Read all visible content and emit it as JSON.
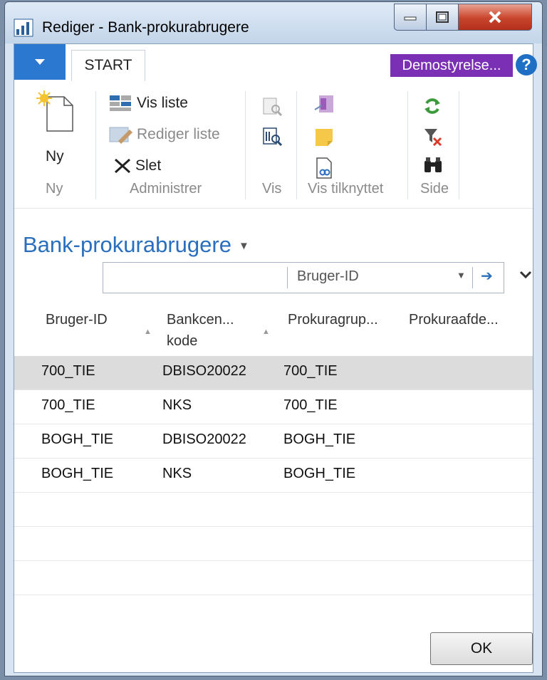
{
  "window": {
    "title": "Rediger - Bank-prokurabrugere"
  },
  "tabs": {
    "start_label": "START"
  },
  "company": {
    "label": "Demostyrelse..."
  },
  "help": {
    "label": "?"
  },
  "ribbon": {
    "ny_label": "Ny",
    "vis_liste": "Vis liste",
    "rediger_liste": "Rediger liste",
    "slet": "Slet",
    "groups": {
      "ny": "Ny",
      "administrer": "Administrer",
      "vis": "Vis",
      "vis_tilknyttet": "Vis tilknyttet",
      "side": "Side"
    }
  },
  "page": {
    "title": "Bank-prokurabrugere"
  },
  "filter": {
    "value": "",
    "field": "Bruger-ID"
  },
  "table": {
    "headers": {
      "col1": "Bruger-ID",
      "col2_line1": "Bankcen...",
      "col2_line2": "kode",
      "col3": "Prokuragrup...",
      "col4": "Prokuraafde..."
    },
    "rows": [
      {
        "bruger_id": "700_TIE",
        "bankcenter": "DBISO20022",
        "gruppe": "700_TIE",
        "afdeling": ""
      },
      {
        "bruger_id": "700_TIE",
        "bankcenter": "NKS",
        "gruppe": "700_TIE",
        "afdeling": ""
      },
      {
        "bruger_id": "BOGH_TIE",
        "bankcenter": "DBISO20022",
        "gruppe": "BOGH_TIE",
        "afdeling": ""
      },
      {
        "bruger_id": "BOGH_TIE",
        "bankcenter": "NKS",
        "gruppe": "BOGH_TIE",
        "afdeling": ""
      }
    ]
  },
  "footer": {
    "ok_label": "OK"
  },
  "colors": {
    "accent": "#2a6fbe",
    "company": "#7b2fb5",
    "selected_row": "#dcdcdc"
  }
}
